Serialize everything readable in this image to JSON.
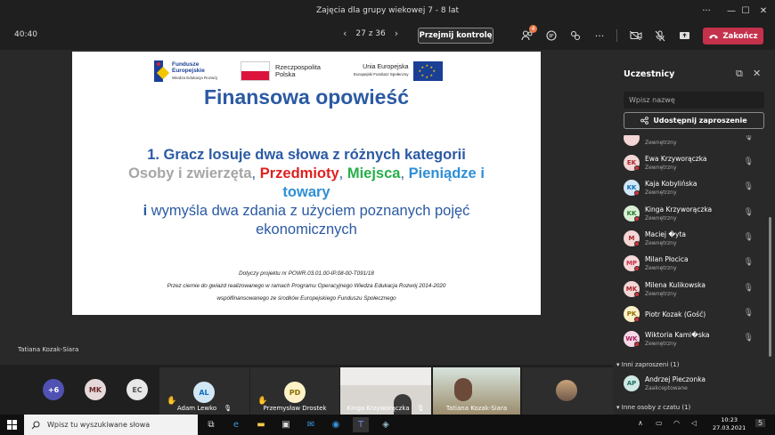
{
  "window": {
    "title": "Zajęcia dla grupy wiekowej 7 - 8 lat",
    "more": "···",
    "minimize": "—",
    "maximize": "☐",
    "close": "✕"
  },
  "toolbar": {
    "timer": "40:40",
    "prev": "‹",
    "page": "27 z 36",
    "next": "›",
    "take_control": "Przejmij kontrolę",
    "participants_badge": "4",
    "end_call": "Zakończ"
  },
  "slide": {
    "logo1_title": "Fundusze",
    "logo1_title2": "Europejskie",
    "logo1_sub": "Wiedza Edukacja Rozwój",
    "logo2_line1": "Rzeczpospolita",
    "logo2_line2": "Polska",
    "logo3_title": "Unia Europejska",
    "logo3_sub": "Europejski Fundusz Społeczny",
    "title": "Finansowa opowieść",
    "line1": "1. Gracz losuje dwa słowa z różnych kategorii",
    "cat1": "Osoby i zwierzęta",
    "comma1": ", ",
    "cat2": "Przedmioty",
    "comma2": ", ",
    "cat3": "Miejsca",
    "comma3": ", ",
    "cat4a": "Pieniądze i",
    "cat4b": "towary",
    "line3a": "i",
    "line3b": " wymyśla dwa zdania z użyciem poznanych pojęć",
    "line4": "ekonomicznych",
    "foot1": "Dotyczy projektu nr POWR.03.01.00-IP.08-00-T091/18",
    "foot2": "Przez ciernie do gwiazd realizowanego w ramach Programu Operacyjnego Wiedza Edukacja Rozwój 2014-2020",
    "foot3": "współfinansowanego ze środków Europejskiego Funduszu Społecznego"
  },
  "presenter": "Tatiana Kozak-Siara",
  "gallery": {
    "more_count": "+6",
    "initials": [
      "MK",
      "EC"
    ],
    "tiles": [
      {
        "initials": "AL",
        "name": "Adam Lewko"
      },
      {
        "initials": "PD",
        "name": "Przemysław Drostek"
      },
      {
        "name": "Kinga Krzyworączka"
      },
      {
        "name": "Tatiana Kozak-Siara"
      }
    ]
  },
  "panel": {
    "title": "Uczestnicy",
    "search_placeholder": "Wpisz nazwę",
    "share": "Udostępnij zaproszenie",
    "top_sub": "Zewnętrzny",
    "participants": [
      {
        "initials": "EK",
        "name": "Ewa Krzyworączka",
        "sub": "Zewnętrzny",
        "bg": "#f4d6d6",
        "fg": "#a4262c"
      },
      {
        "initials": "KK",
        "name": "Kaja Kobylińska",
        "sub": "Zewnętrzny",
        "bg": "#d2e7f5",
        "fg": "#0f6cbd"
      },
      {
        "initials": "KK",
        "name": "Kinga Krzyworączka",
        "sub": "Zewnętrzny",
        "bg": "#d9f0d6",
        "fg": "#2a7a2a"
      },
      {
        "initials": "M",
        "name": "Maciej �yta",
        "sub": "Zewnętrzny",
        "bg": "#f4d6d6",
        "fg": "#a4262c"
      },
      {
        "initials": "MP",
        "name": "Milan Płocica",
        "sub": "Zewnętrzny",
        "bg": "#f7d8d8",
        "fg": "#c4314b"
      },
      {
        "initials": "MK",
        "name": "Milena Kulikowska",
        "sub": "Zewnętrzny",
        "bg": "#f4d6d6",
        "fg": "#a4262c"
      },
      {
        "initials": "PK",
        "name": "Piotr Kozak (Gość)",
        "sub": "",
        "bg": "#fdf1c7",
        "fg": "#8a6d00"
      },
      {
        "initials": "WK",
        "name": "Wiktoria Kami�ska",
        "sub": "Zewnętrzny",
        "bg": "#f7d8e8",
        "fg": "#a4265c"
      }
    ],
    "section_invited": "Inni zaproszeni (1)",
    "invited": {
      "initials": "AP",
      "name": "Andrzej Pieczonka",
      "sub": "Zaakceptowane",
      "bg": "#cfe9e4",
      "fg": "#1f6f60"
    },
    "section_chat": "Inne osoby z czatu (1)"
  },
  "taskbar": {
    "search_placeholder": "Wpisz tu wyszukiwane słowa",
    "time": "10:23",
    "date": "27.03.2021",
    "notif": "5"
  }
}
